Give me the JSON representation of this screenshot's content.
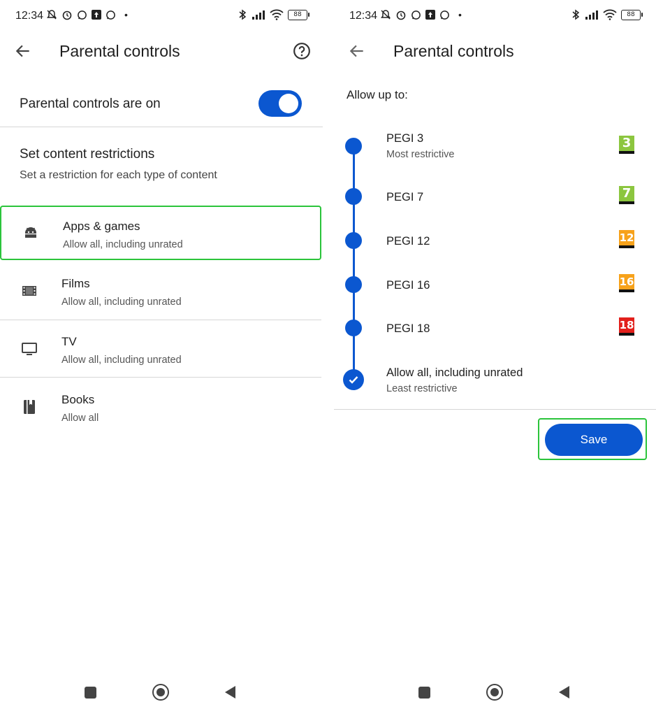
{
  "status_bar": {
    "time": "12:34",
    "battery": "88"
  },
  "left_screen": {
    "title": "Parental controls",
    "toggle": {
      "label": "Parental controls are on",
      "on": true
    },
    "section": {
      "heading": "Set content restrictions",
      "subheading": "Set a restriction for each type of content"
    },
    "items": [
      {
        "title": "Apps & games",
        "subtitle": "Allow all, including unrated",
        "icon": "android-icon"
      },
      {
        "title": "Films",
        "subtitle": "Allow all, including unrated",
        "icon": "film-icon"
      },
      {
        "title": "TV",
        "subtitle": "Allow all, including unrated",
        "icon": "tv-icon"
      },
      {
        "title": "Books",
        "subtitle": "Allow all",
        "icon": "book-icon"
      }
    ]
  },
  "right_screen": {
    "title": "Parental controls",
    "allow_label": "Allow up to:",
    "options": [
      {
        "name": "PEGI 3",
        "sub": "Most restrictive",
        "badge": "3",
        "color": "#8cc63f"
      },
      {
        "name": "PEGI 7",
        "sub": "",
        "badge": "7",
        "color": "#8cc63f"
      },
      {
        "name": "PEGI 12",
        "sub": "",
        "badge": "12",
        "color": "#f7a21b"
      },
      {
        "name": "PEGI 16",
        "sub": "",
        "badge": "16",
        "color": "#f7a21b"
      },
      {
        "name": "PEGI 18",
        "sub": "",
        "badge": "18",
        "color": "#e2201c"
      },
      {
        "name": "Allow all, including unrated",
        "sub": "Least restrictive",
        "badge": "",
        "color": ""
      }
    ],
    "selected_index": 5,
    "save_label": "Save"
  },
  "colors": {
    "accent": "#0b57d0",
    "highlight": "#2bc43b"
  }
}
